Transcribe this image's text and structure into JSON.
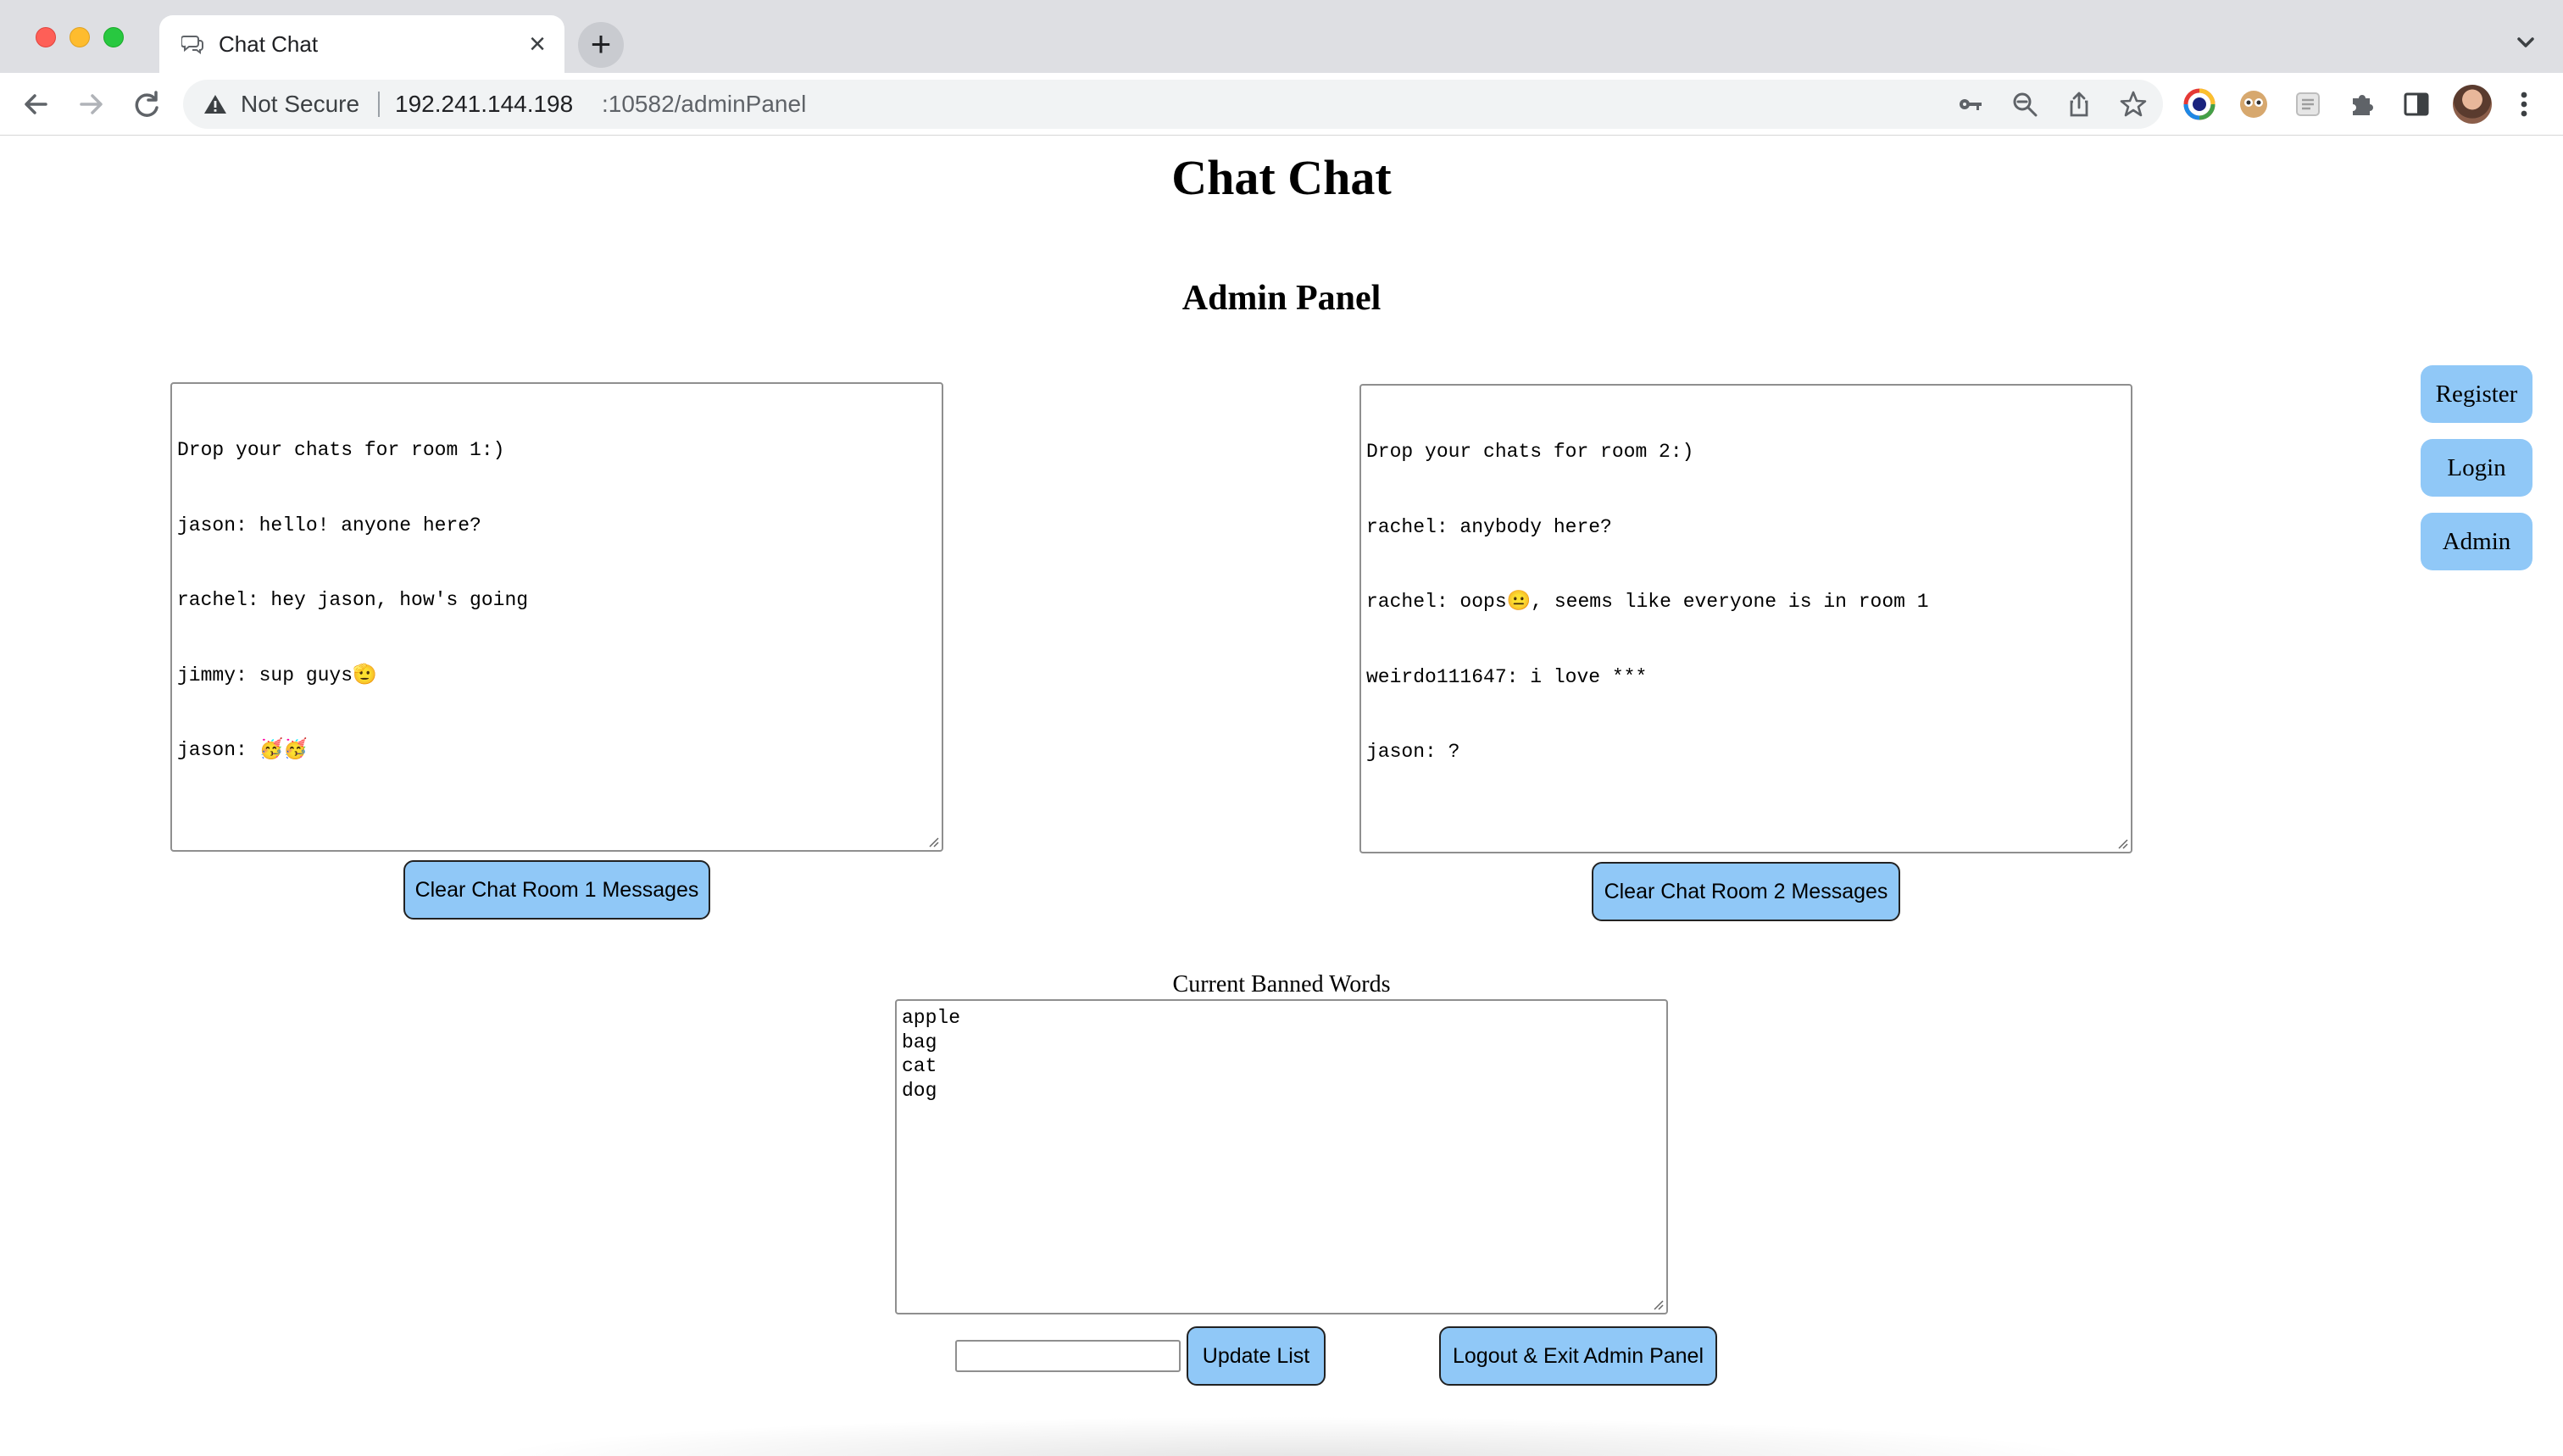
{
  "browser": {
    "tab_title": "Chat Chat",
    "new_tab_symbol": "+",
    "close_tab_symbol": "×",
    "security_label": "Not Secure",
    "url_host": "192.241.144.198",
    "url_path": ":10582/adminPanel",
    "icons": [
      "back-arrow",
      "forward-arrow",
      "reload",
      "warning",
      "key",
      "zoom-out",
      "share",
      "star",
      "extensions-puzzle",
      "side-panel",
      "profile",
      "menu-dots"
    ]
  },
  "page": {
    "site_title": "Chat Chat",
    "panel_title": "Admin Panel",
    "room1": {
      "lines": [
        "Drop your chats for room 1:)",
        "jason: hello! anyone here?",
        "rachel: hey jason, how's going",
        "jimmy: sup guys🫡",
        "jason: 🥳🥳"
      ],
      "clear_button": "Clear Chat Room 1 Messages"
    },
    "room2": {
      "lines": [
        "Drop your chats for room 2:)",
        "rachel: anybody here?",
        "rachel: oops😐, seems like everyone is in room 1",
        "weirdo111647: i love ***",
        "jason: ?"
      ],
      "clear_button": "Clear Chat Room 2 Messages"
    },
    "side_nav": {
      "register": "Register",
      "login": "Login",
      "admin": "Admin"
    },
    "banned": {
      "label": "Current Banned Words",
      "words": [
        "apple",
        "bag",
        "cat",
        "dog"
      ],
      "input_value": "",
      "update_button": "Update List"
    },
    "logout_button": "Logout & Exit Admin Panel",
    "colors": {
      "button_bg": "#90c8f7",
      "page_bg": "#ffffff",
      "chrome_bg": "#dedfe3"
    }
  }
}
